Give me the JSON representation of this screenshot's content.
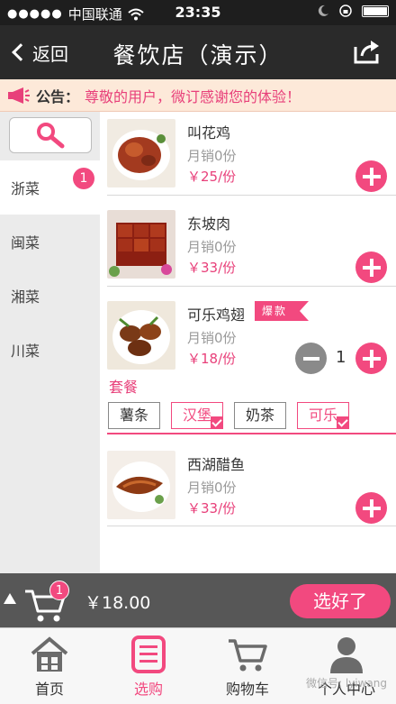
{
  "status": {
    "carrier": "中国联通",
    "time": "23:35"
  },
  "nav": {
    "back_label": "返回",
    "title": "餐饮店（演示）"
  },
  "notice": {
    "label": "公告：",
    "text": "尊敬的用户，微订感谢您的体验！"
  },
  "sidebar": {
    "categories": [
      {
        "label": "浙菜",
        "active": true,
        "badge": "1"
      },
      {
        "label": "闽菜"
      },
      {
        "label": "湘菜"
      },
      {
        "label": "川菜"
      }
    ]
  },
  "items": [
    {
      "name": "叫花鸡",
      "sales": "月销0份",
      "price": "￥25/份"
    },
    {
      "name": "东坡肉",
      "sales": "月销0份",
      "price": "￥33/份"
    },
    {
      "name": "可乐鸡翅",
      "sales": "月销0份",
      "price": "￥18/份",
      "tag": "爆款",
      "qty": "1"
    },
    {
      "name": "西湖醋鱼",
      "sales": "月销0份",
      "price": "￥33/份"
    }
  ],
  "combo": {
    "title": "套餐",
    "options": [
      {
        "label": "薯条",
        "selected": false
      },
      {
        "label": "汉堡",
        "selected": true
      },
      {
        "label": "奶茶",
        "selected": false
      },
      {
        "label": "可乐",
        "selected": true
      }
    ]
  },
  "cart": {
    "badge": "1",
    "total": "￥18.00",
    "done_label": "选好了"
  },
  "tabs": [
    {
      "label": "首页",
      "icon": "home-icon"
    },
    {
      "label": "选购",
      "icon": "menu-list-icon",
      "active": true
    },
    {
      "label": "购物车",
      "icon": "shopping-cart-icon"
    },
    {
      "label": "个人中心",
      "icon": "user-icon"
    }
  ],
  "watermark": "微信号: lyiwang",
  "colors": {
    "accent": "#f2497f",
    "nav_bg": "#2a2a2a",
    "notice_bg": "#fde9d9"
  }
}
